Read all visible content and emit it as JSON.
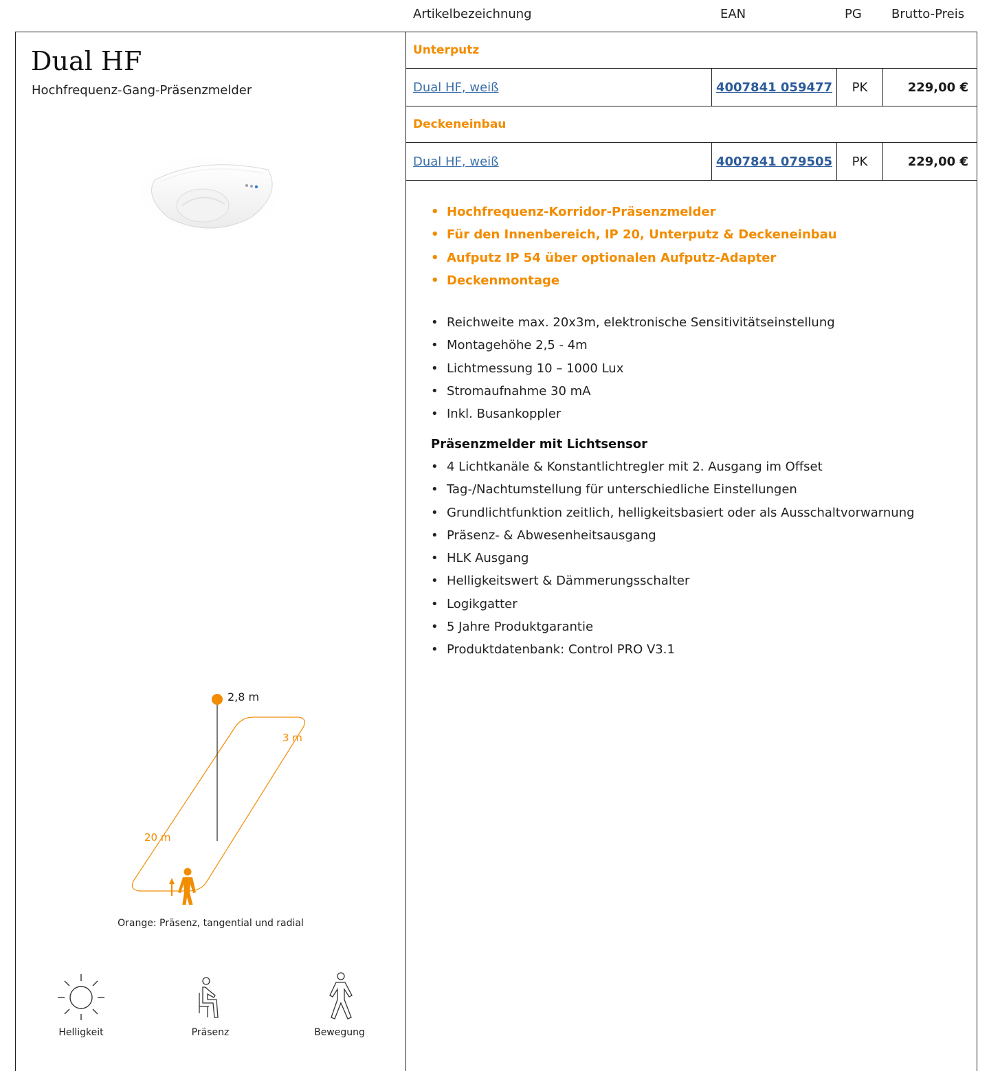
{
  "header": {
    "col_name": "Artikelbezeichnung",
    "col_ean": "EAN",
    "col_pg": "PG",
    "col_price": "Brutto-Preis"
  },
  "product": {
    "title": "Dual HF",
    "subtitle": "Hochfrequenz-Gang-Präsenzmelder"
  },
  "sections": [
    {
      "label": "Unterputz",
      "item": {
        "name": "Dual HF, weiß",
        "ean": "4007841 059477",
        "pg": "PK",
        "price": "229,00 €"
      }
    },
    {
      "label": "Deckeneinbau",
      "item": {
        "name": "Dual HF, weiß",
        "ean": "4007841 079505",
        "pg": "PK",
        "price": "229,00 €"
      }
    }
  ],
  "highlights": [
    "Hochfrequenz-Korridor-Präsenzmelder",
    "Für den Innenbereich, IP 20, Unterputz & Deckeneinbau",
    "Aufputz IP 54 über optionalen Aufputz-Adapter",
    "Deckenmontage"
  ],
  "specs": [
    "Reichweite max. 20x3m, elektronische Sensitivitätseinstellung",
    "Montagehöhe 2,5 - 4m",
    "Lichtmessung 10 – 1000 Lux",
    "Stromaufnahme 30 mA",
    "Inkl. Busankoppler"
  ],
  "subsection_title": "Präsenzmelder mit Lichtsensor",
  "subsection_items": [
    "4 Lichtkanäle & Konstantlichtregler mit 2. Ausgang im Offset",
    "Tag-/Nachtumstellung für unterschiedliche Einstellungen",
    "Grundlichtfunktion zeitlich, helligkeitsbasiert oder als Ausschaltvorwarnung",
    "Präsenz- & Abwesenheitsausgang",
    "HLK Ausgang",
    "Helligkeitswert & Dämmerungsschalter",
    "Logikgatter",
    "5 Jahre Produktgarantie",
    "Produktdatenbank: Control PRO V3.1"
  ],
  "diagram": {
    "height_label": "2,8 m",
    "width_label": "3 m",
    "length_label": "20 m",
    "caption": "Orange: Präsenz, tangential und radial",
    "accent_color": "#f28c00"
  },
  "features": [
    {
      "label": "Helligkeit",
      "icon": "sun-icon"
    },
    {
      "label": "Präsenz",
      "icon": "seated-person-icon"
    },
    {
      "label": "Bewegung",
      "icon": "walking-person-icon"
    }
  ]
}
